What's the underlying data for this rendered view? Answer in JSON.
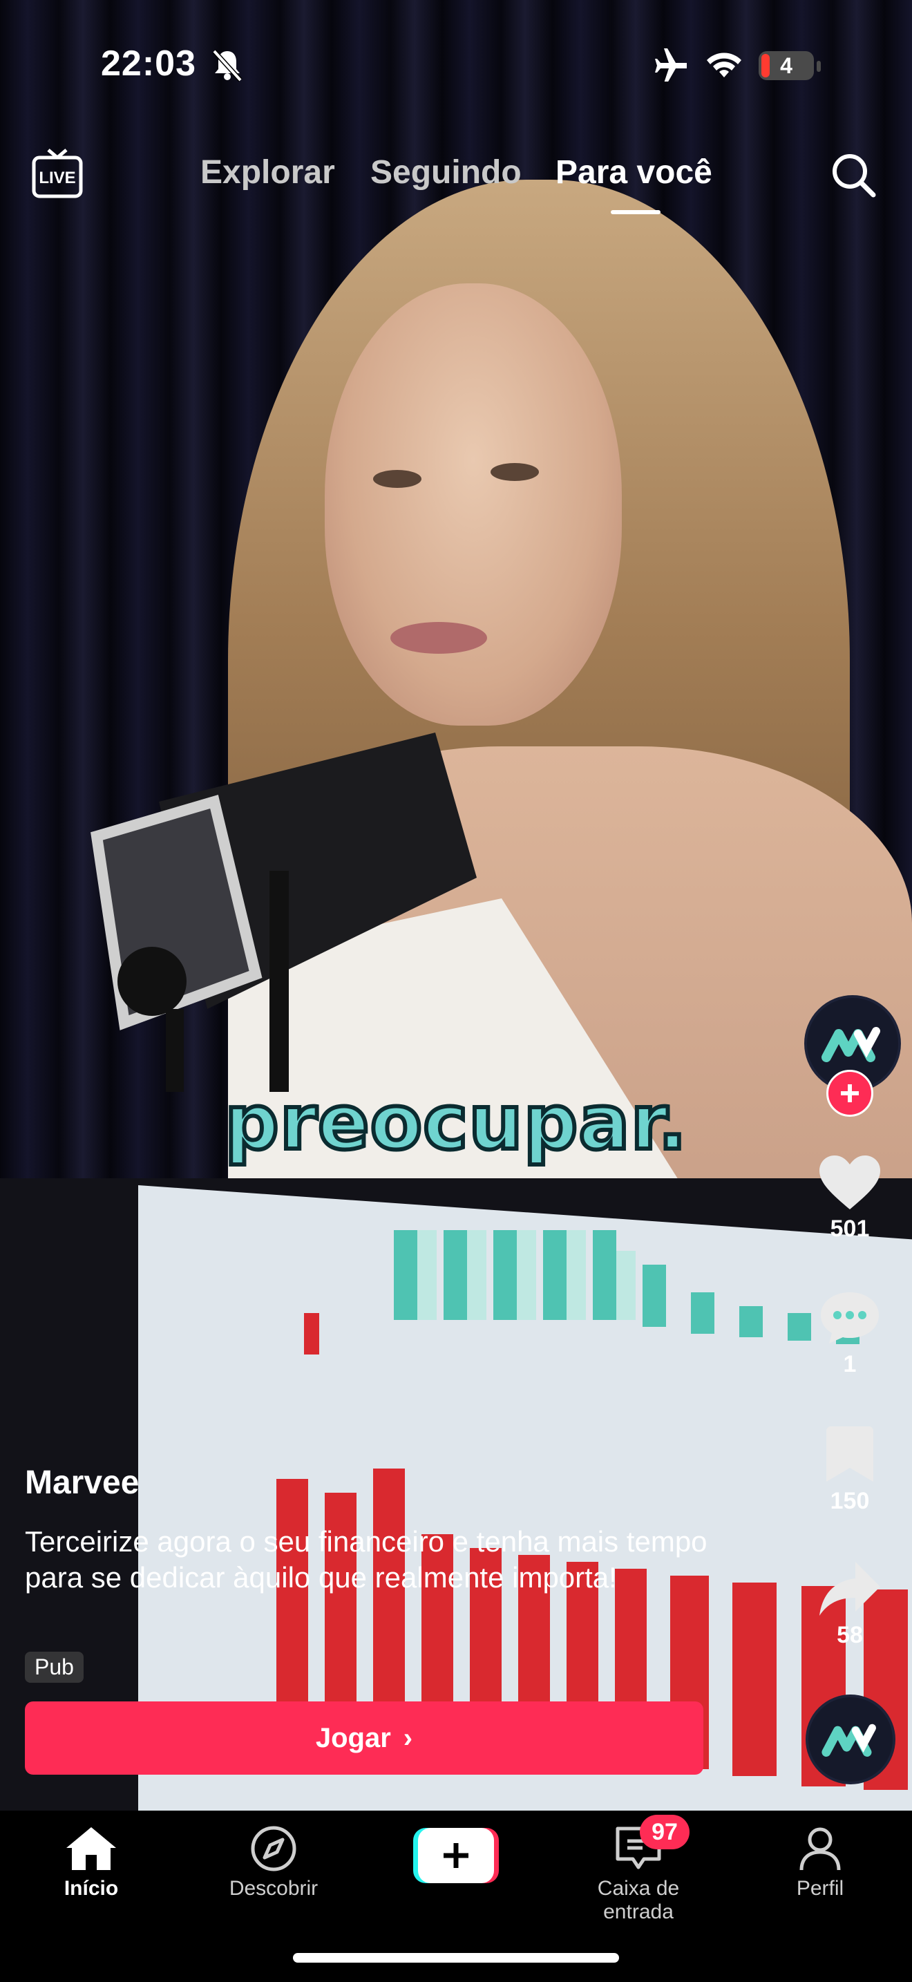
{
  "status_bar": {
    "time": "22:03",
    "battery": "4"
  },
  "top_nav": {
    "live_label": "LIVE",
    "tabs": [
      {
        "label": "Explorar"
      },
      {
        "label": "Seguindo"
      },
      {
        "label": "Para você",
        "active": true
      }
    ]
  },
  "video": {
    "caption": "preocupar."
  },
  "rail": {
    "likes": "501",
    "comments": "1",
    "saves": "150",
    "shares": "58"
  },
  "post": {
    "author": "Marvee",
    "description": "Terceirize agora o seu financeiro e tenha mais tempo para se dedicar àquilo que realmente importa!",
    "tag": "Pub",
    "cta_label": "Jogar",
    "cta_arrow": "›"
  },
  "bottom_nav": {
    "items": [
      {
        "label": "Início",
        "icon": "home-icon",
        "active": true
      },
      {
        "label": "Descobrir",
        "icon": "compass-icon"
      },
      {
        "label": "",
        "icon": "plus-icon"
      },
      {
        "label": "Caixa de entrada",
        "icon": "inbox-icon"
      },
      {
        "label": "Perfil",
        "icon": "profile-icon"
      }
    ],
    "inbox_badge": "97"
  },
  "colors": {
    "accent": "#fe2c55",
    "caption": "#6fd3cf",
    "chart_green": "#4fc3b2",
    "chart_red": "#d9292f"
  }
}
